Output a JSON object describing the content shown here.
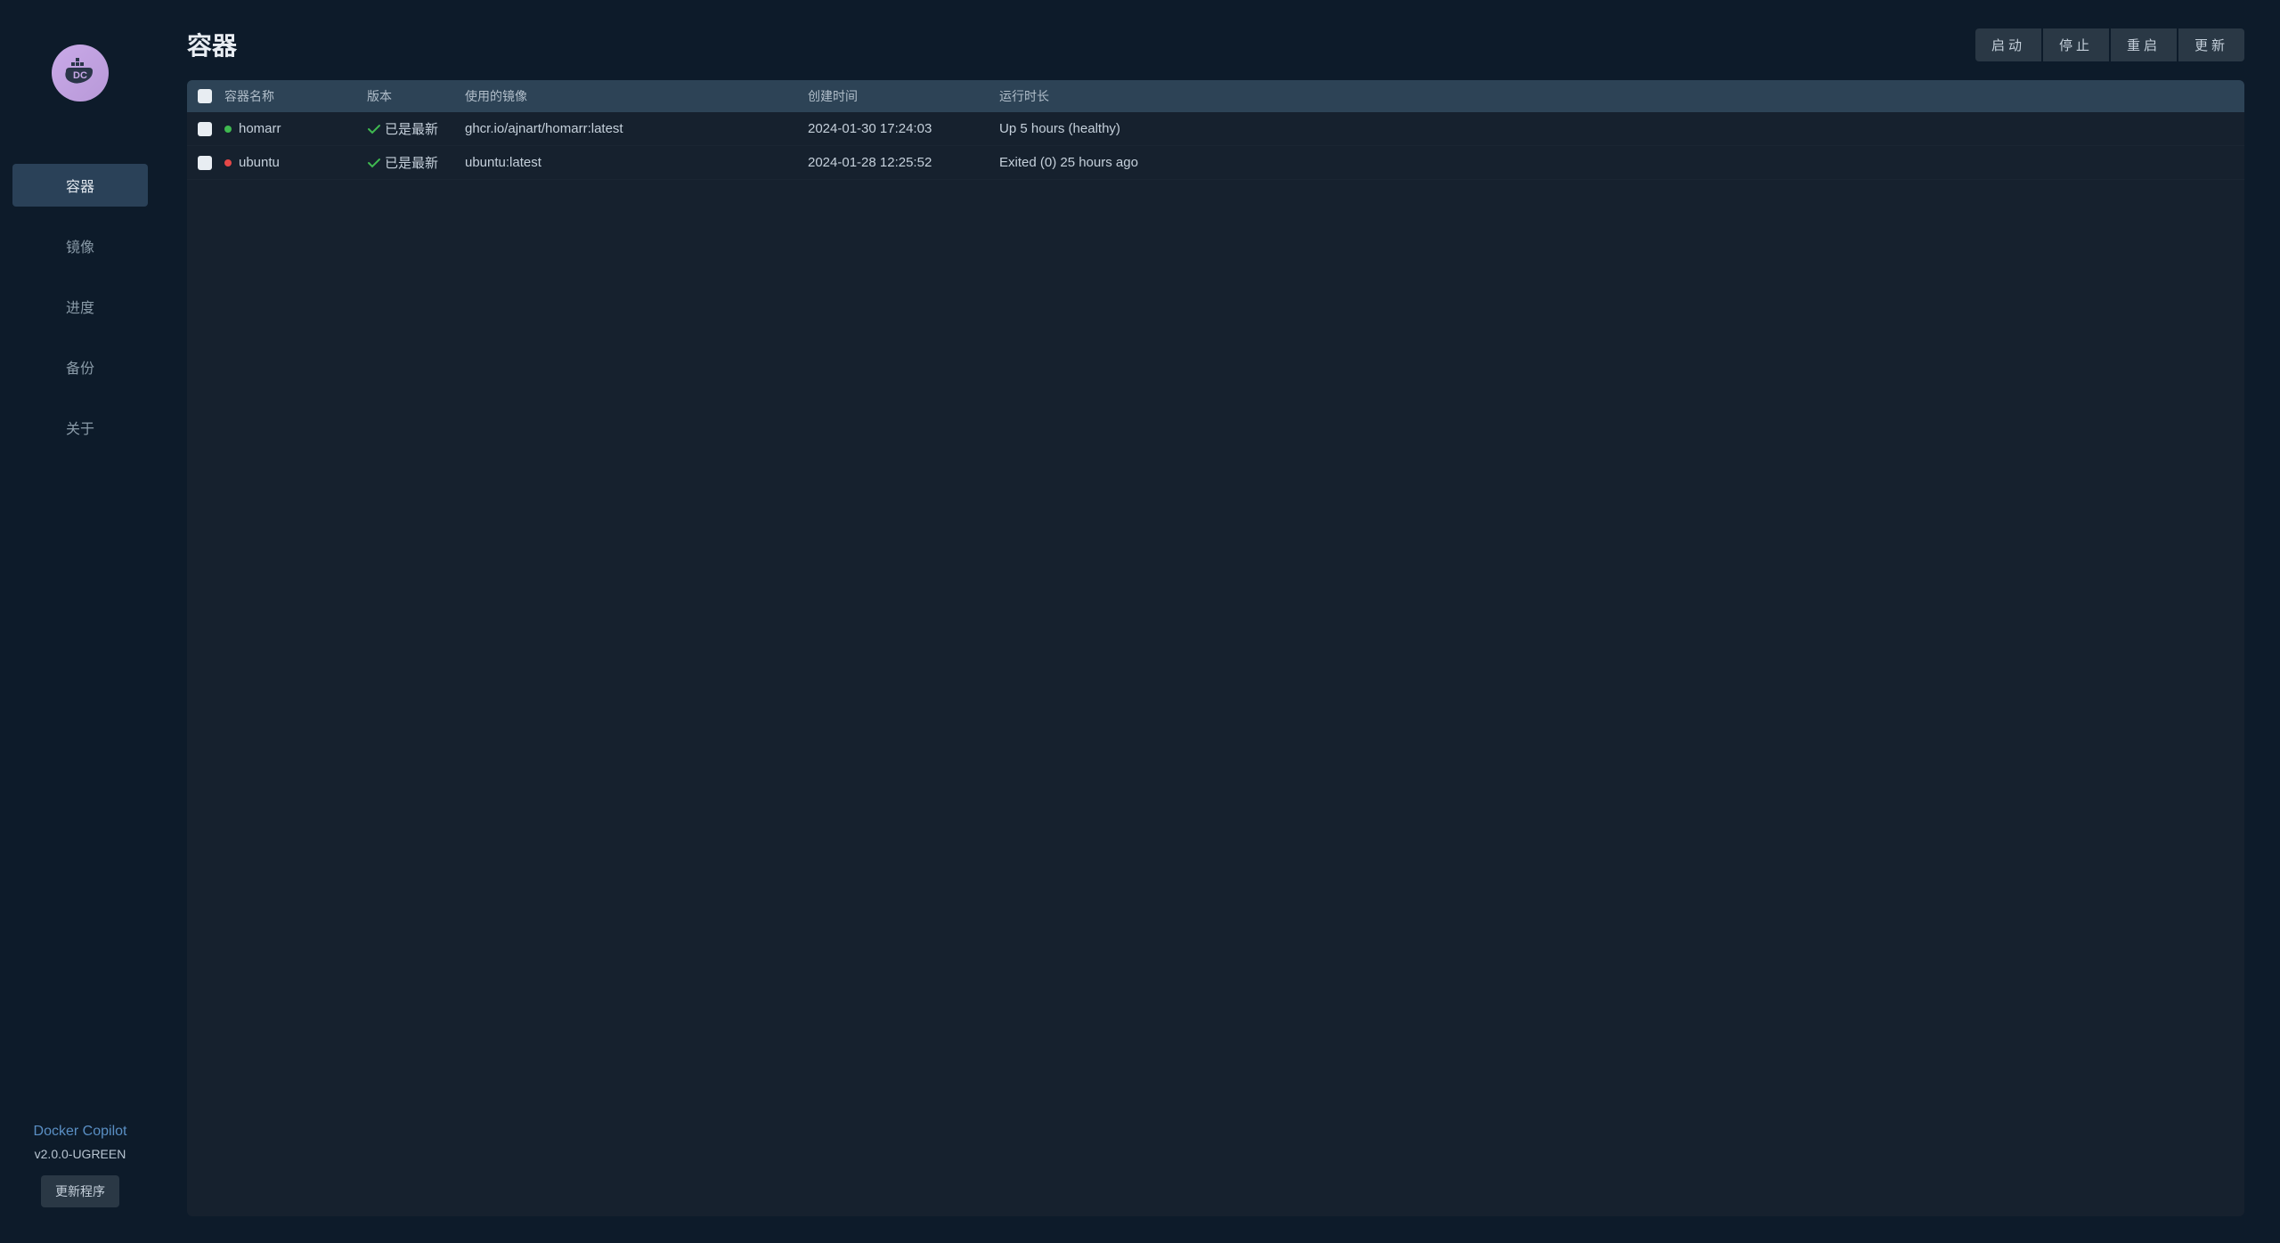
{
  "sidebar": {
    "appName": "Docker Copilot",
    "version": "v2.0.0-UGREEN",
    "updateButton": "更新程序",
    "navItems": [
      {
        "label": "容器",
        "active": true
      },
      {
        "label": "镜像",
        "active": false
      },
      {
        "label": "进度",
        "active": false
      },
      {
        "label": "备份",
        "active": false
      },
      {
        "label": "关于",
        "active": false
      }
    ]
  },
  "header": {
    "title": "容器",
    "actions": {
      "start": "启动",
      "stop": "停止",
      "restart": "重启",
      "update": "更新"
    }
  },
  "table": {
    "columns": {
      "name": "容器名称",
      "version": "版本",
      "image": "使用的镜像",
      "created": "创建时间",
      "runtime": "运行时长"
    },
    "rows": [
      {
        "statusColor": "green",
        "name": "homarr",
        "versionStatus": "已是最新",
        "image": "ghcr.io/ajnart/homarr:latest",
        "created": "2024-01-30 17:24:03",
        "runtime": "Up 5 hours (healthy)"
      },
      {
        "statusColor": "red",
        "name": "ubuntu",
        "versionStatus": "已是最新",
        "image": "ubuntu:latest",
        "created": "2024-01-28 12:25:52",
        "runtime": "Exited (0) 25 hours ago"
      }
    ]
  }
}
